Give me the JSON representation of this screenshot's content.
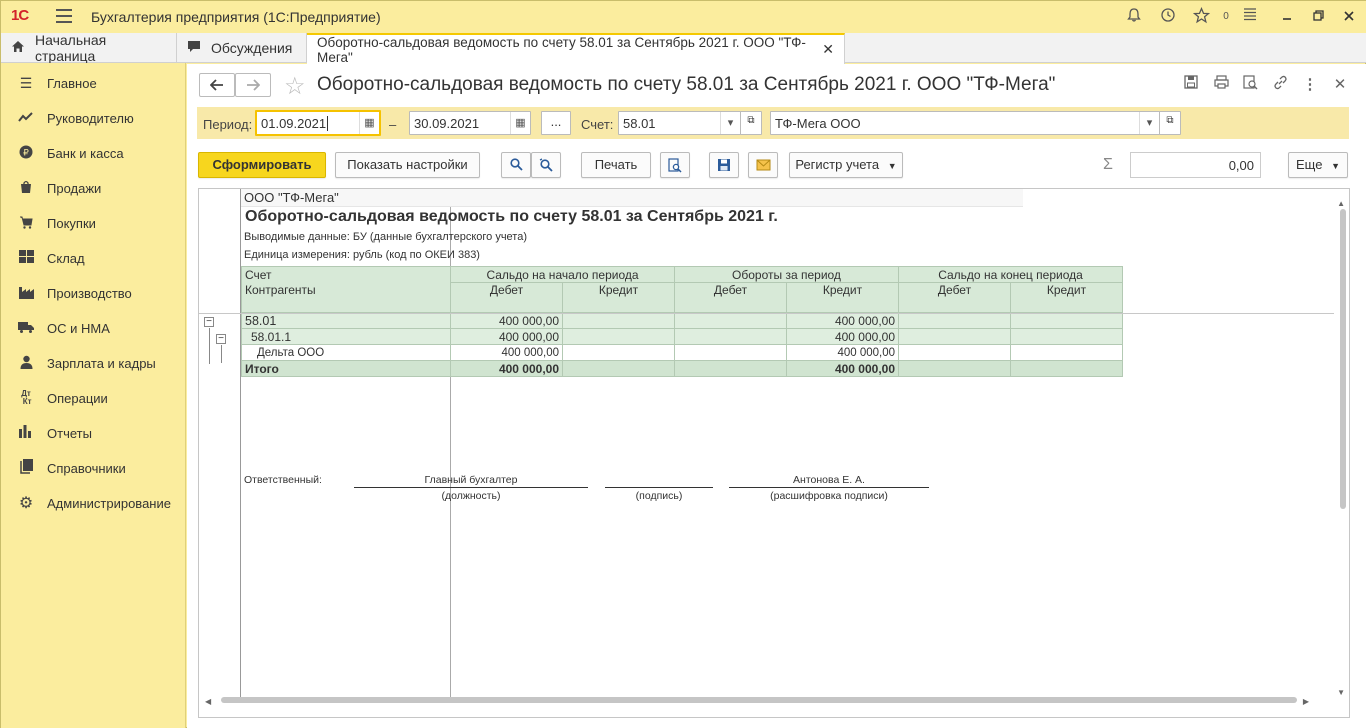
{
  "app": {
    "logo": "1С",
    "title": "Бухгалтерия предприятия (1С:Предприятие)",
    "notif_count": "0"
  },
  "tabs": [
    {
      "label": "Начальная страница"
    },
    {
      "label": "Обсуждения"
    },
    {
      "label": "Оборотно-сальдовая ведомость по счету 58.01 за Сентябрь 2021 г. ООО \"ТФ-Мега\""
    }
  ],
  "sidebar": {
    "items": [
      {
        "label": "Главное",
        "icon": "menu-icon"
      },
      {
        "label": "Руководителю",
        "icon": "trend-icon"
      },
      {
        "label": "Банк и касса",
        "icon": "ruble-icon"
      },
      {
        "label": "Продажи",
        "icon": "bag-icon"
      },
      {
        "label": "Покупки",
        "icon": "cart-icon"
      },
      {
        "label": "Склад",
        "icon": "warehouse-icon"
      },
      {
        "label": "Производство",
        "icon": "factory-icon"
      },
      {
        "label": "ОС и НМА",
        "icon": "truck-icon"
      },
      {
        "label": "Зарплата и кадры",
        "icon": "person-icon"
      },
      {
        "label": "Операции",
        "icon": "dt-kt-icon"
      },
      {
        "label": "Отчеты",
        "icon": "bar-chart-icon"
      },
      {
        "label": "Справочники",
        "icon": "book-icon"
      },
      {
        "label": "Администрирование",
        "icon": "gear-icon"
      }
    ]
  },
  "doc": {
    "title": "Оборотно-сальдовая ведомость по счету 58.01 за Сентябрь 2021 г. ООО \"ТФ-Мега\""
  },
  "filter": {
    "period_label": "Период:",
    "date_from": "01.09.2021",
    "dash": "–",
    "date_to": "30.09.2021",
    "ellipsis": "...",
    "account_label": "Счет:",
    "account": "58.01",
    "org": "ТФ-Мега ООО"
  },
  "toolbar": {
    "generate": "Сформировать",
    "settings": "Показать настройки",
    "print": "Печать",
    "register": "Регистр учета",
    "sum_value": "0,00",
    "more": "Еще"
  },
  "report": {
    "org": "ООО \"ТФ-Мега\"",
    "title": "Оборотно-сальдовая ведомость по счету 58.01 за Сентябрь 2021 г.",
    "data_line": "Выводимые данные:  БУ (данные бухгалтерского учета)",
    "unit_line": "Единица измерения:  рубль (код по ОКЕИ 383)",
    "headers": {
      "account": "Счет",
      "counterparty": "Контрагенты",
      "open": "Сальдо на начало периода",
      "turn": "Обороты за период",
      "close": "Сальдо на конец периода",
      "debit": "Дебет",
      "credit": "Кредит"
    },
    "rows": [
      {
        "name": "58.01",
        "open_d": "400 000,00",
        "open_c": "",
        "turn_d": "",
        "turn_c": "400 000,00",
        "close_d": "",
        "close_c": ""
      },
      {
        "name": "58.01.1",
        "open_d": "400 000,00",
        "open_c": "",
        "turn_d": "",
        "turn_c": "400 000,00",
        "close_d": "",
        "close_c": ""
      },
      {
        "name": "Дельта ООО",
        "open_d": "400 000,00",
        "open_c": "",
        "turn_d": "",
        "turn_c": "400 000,00",
        "close_d": "",
        "close_c": ""
      },
      {
        "name": "Итого",
        "open_d": "400 000,00",
        "open_c": "",
        "turn_d": "",
        "turn_c": "400 000,00",
        "close_d": "",
        "close_c": ""
      }
    ],
    "sign": {
      "responsible": "Ответственный:",
      "position": "Главный бухгалтер",
      "position_caption": "(должность)",
      "signature_caption": "(подпись)",
      "name": "Антонова Е. А.",
      "name_caption": "(расшифровка подписи)"
    }
  }
}
